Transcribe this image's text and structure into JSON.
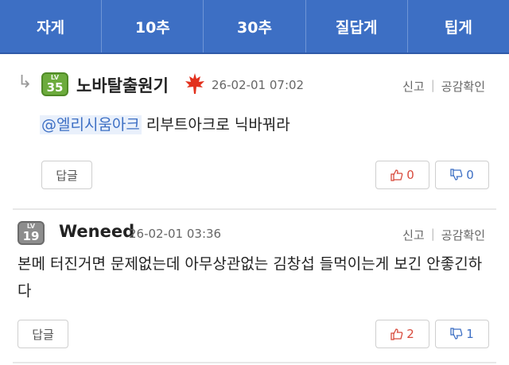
{
  "tabs": [
    {
      "label": "자게"
    },
    {
      "label": "10추"
    },
    {
      "label": "30추"
    },
    {
      "label": "질답게"
    },
    {
      "label": "팁게"
    }
  ],
  "comments": [
    {
      "level_label": "LV",
      "level": "35",
      "nickname": "노바탈출원기",
      "date": "26-02-01 07:02",
      "report": "신고",
      "separator": "|",
      "like_check": "공감확인",
      "mention": "@엘리시움아크",
      "text": " 리부트아크로 닉바꿔라",
      "reply_label": "답글",
      "upvotes": "0",
      "downvotes": "0"
    },
    {
      "level_label": "LV",
      "level": "19",
      "nickname": "Weneed",
      "date": "26-02-01 03:36",
      "report": "신고",
      "separator": "|",
      "like_check": "공감확인",
      "text": "본메 터진거면 문제없는데 아무상관없는 김창섭 들먹이는게 보긴 안좋긴하다",
      "reply_label": "답글",
      "upvotes": "2",
      "downvotes": "1"
    }
  ],
  "colors": {
    "tab_bar": "#3d6fc4",
    "level_35": "#6cab3c",
    "level_19": "#8d8d8d",
    "upvote": "#d84a3c",
    "downvote": "#3d6fc4"
  }
}
